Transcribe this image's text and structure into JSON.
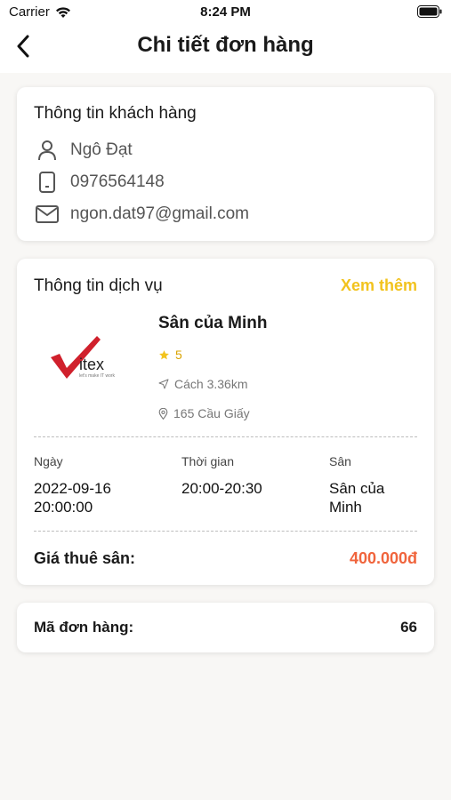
{
  "status_bar": {
    "carrier": "Carrier",
    "time": "8:24 PM"
  },
  "header": {
    "title": "Chi tiết đơn hàng"
  },
  "customer": {
    "title": "Thông tin khách hàng",
    "name": "Ngô Đạt",
    "phone": "0976564148",
    "email": "ngon.dat97@gmail.com"
  },
  "service": {
    "title": "Thông tin dịch vụ",
    "see_more": "Xem thêm",
    "venue_name": "Sân của Minh",
    "rating": "5",
    "distance": "Cách 3.36km",
    "address": "165 Cầu Giấy",
    "logo_text": "itex",
    "logo_tagline": "let's make IT work",
    "columns": [
      {
        "label": "Ngày",
        "value": "2022-09-16\n20:00:00"
      },
      {
        "label": "Thời gian",
        "value": "20:00-20:30"
      },
      {
        "label": "Sân",
        "value": "Sân của\nMinh"
      }
    ],
    "price_label": "Giá thuê sân:",
    "price_value": "400.000đ"
  },
  "order": {
    "label": "Mã đơn hàng:",
    "value": "66"
  },
  "colors": {
    "accent": "#f2c31e",
    "price": "#f0643c",
    "logo_red": "#d0202c"
  }
}
